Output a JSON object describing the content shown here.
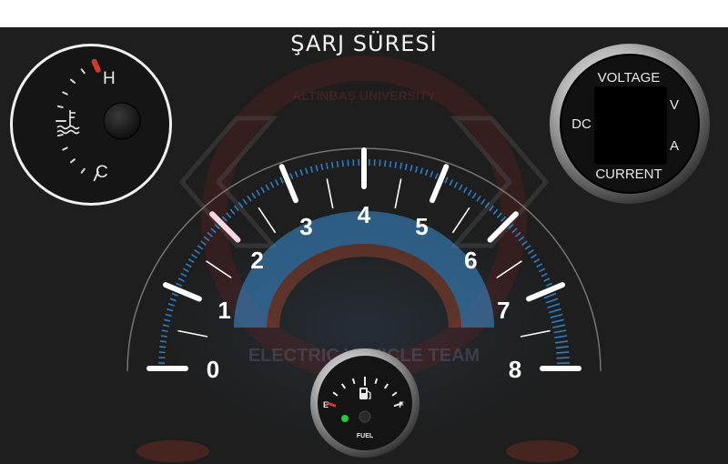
{
  "header": {
    "title": "ŞARJ SÜRESİ"
  },
  "watermark": {
    "org_top": "ALTINBAŞ UNIVERSITY",
    "team": "ELECTRIC VEHICLE TEAM"
  },
  "temp_gauge": {
    "hot_label": "H",
    "cold_label": "C",
    "icon": "coolant-temperature-icon"
  },
  "meter": {
    "label_dc": "DC",
    "label_voltage": "VOLTAGE",
    "label_v": "V",
    "label_a": "A",
    "label_current": "CURRENT"
  },
  "speedometer": {
    "tick_labels": [
      "0",
      "1",
      "2",
      "3",
      "4",
      "5",
      "6",
      "7",
      "8"
    ],
    "scale_min": 0,
    "scale_max": 8,
    "accent_color": "#2f8fe0"
  },
  "fuel_gauge": {
    "empty_label": "E",
    "full_label": "F",
    "caption": "FUEL",
    "icon": "fuel-pump-icon",
    "indicator_color": "#22cc33"
  }
}
